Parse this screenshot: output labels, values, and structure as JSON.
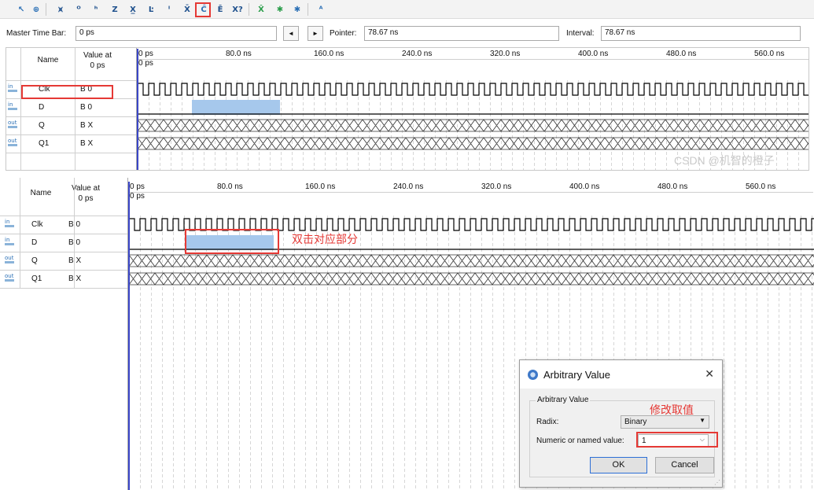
{
  "toolbar": {
    "icons": [
      "selection-tool-icon",
      "zoom-tool-icon",
      "forcing-unknown-icon",
      "forcing-low-icon",
      "forcing-high-icon",
      "forcing-high-impedance-icon",
      "forcing-weak-unknown-icon",
      "forcing-weak-low-icon",
      "invert-icon",
      "count-value-icon",
      "clock-icon",
      "forcing-weak-high-icon",
      "dont-care-icon",
      "arbitrary-value-icon",
      "random-value-icon",
      "snap-to-grid-icon",
      "sort-icon"
    ]
  },
  "top_panel": {
    "master_time_bar_label": "Master Time Bar:",
    "master_time_bar_value": "0 ps",
    "pointer_label": "Pointer:",
    "pointer_value": "78.67 ns",
    "interval_label": "Interval:",
    "interval_value": "78.67 ns",
    "prev_glyph": "◄",
    "next_glyph": "►"
  },
  "columns": {
    "name": "Name",
    "value_at_line1": "Value at",
    "value_at_line2": "0 ps"
  },
  "timeline": {
    "ticks": [
      "0 ps",
      "80.0 ns",
      "160.0 ns",
      "240.0 ns",
      "320.0 ns",
      "400.0 ns",
      "480.0 ns",
      "560.0 ns"
    ],
    "cursor_label": "0 ps"
  },
  "signals": [
    {
      "io": "in",
      "name": "Clk",
      "value": "B 0"
    },
    {
      "io": "in",
      "name": "D",
      "value": "B 0"
    },
    {
      "io": "out",
      "name": "Q",
      "value": "B X"
    },
    {
      "io": "out",
      "name": "Q1",
      "value": "B X"
    }
  ],
  "annotations": {
    "double_click": "双击对应部分",
    "modify_value": "修改取值",
    "watermark": "CSDN @机智的橙子"
  },
  "dialog": {
    "title": "Arbitrary Value",
    "close_glyph": "✕",
    "group_label": "Arbitrary Value",
    "radix_label": "Radix:",
    "radix_value": "Binary",
    "numeric_label": "Numeric or named value:",
    "numeric_value": "1",
    "ok_label": "OK",
    "cancel_label": "Cancel"
  },
  "colors": {
    "accent_red": "#e53935",
    "selection_blue": "#a6c8ec",
    "marker_blue": "#3a46c8"
  }
}
